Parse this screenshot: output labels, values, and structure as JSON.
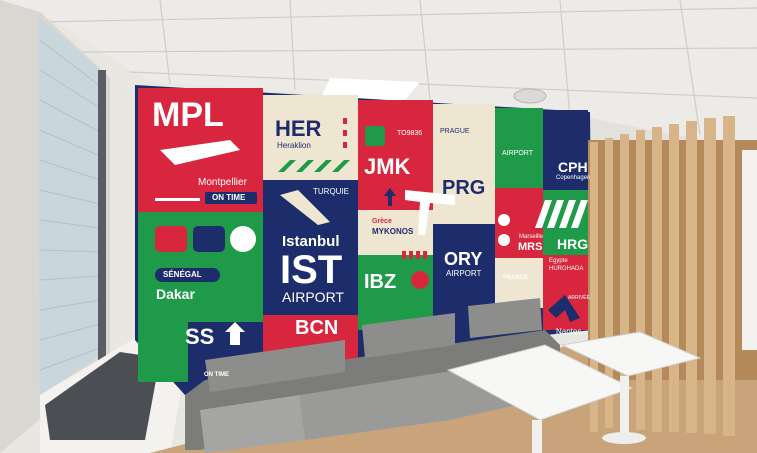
{
  "mural": {
    "mpl": {
      "code": "MPL",
      "city": "Montpellier",
      "status": "ON TIME"
    },
    "her": {
      "code": "HER",
      "city": "Heraklion"
    },
    "ist": {
      "country": "TURQUIE",
      "city": "Istanbul",
      "code": "IST",
      "label": "AIRPORT"
    },
    "jmk": {
      "flight": "TO9836",
      "code": "JMK",
      "country": "Grèce",
      "city": "MYKONOS"
    },
    "prg": {
      "country": "PRAGUE",
      "code": "PRG"
    },
    "cph": {
      "label": "AIRPORT",
      "code": "CPH",
      "city": "Copenhagen"
    },
    "mrs": {
      "city": "Marseille",
      "code": "MRS",
      "country": "FRANCE"
    },
    "hrg": {
      "code": "HRG",
      "country": "Egypte",
      "city": "HURGHADA"
    },
    "dakar": {
      "country": "SÉNÉGAL",
      "city": "Dakar"
    },
    "ibz": {
      "code": "IBZ"
    },
    "ory": {
      "code": "ORY",
      "label": "AIRPORT"
    },
    "bcn": {
      "code": "BCN"
    },
    "lss": {
      "code": "SS"
    },
    "bottom": {
      "status": "ON TIME"
    },
    "nantes": {
      "city": "Nantes"
    },
    "arrivee": {
      "label": "ARRIVÉE"
    }
  },
  "colors": {
    "red": "#d7263d",
    "navy": "#1d2d6b",
    "green": "#1f9a48",
    "beige": "#efe6d2",
    "wall": "#e6e4df",
    "sofa": "#8a8a88",
    "floor": "#c9a47a",
    "wood": "#caa67a"
  }
}
